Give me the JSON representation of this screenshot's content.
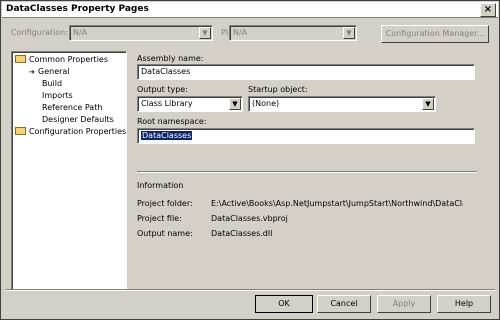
{
  "window": {
    "title": "DataClasses Property Pages",
    "close_glyph": "×"
  },
  "header": {
    "configuration_label": "Configuration:",
    "configuration_value": "N/A",
    "platform_label": "Platform:",
    "platform_value": "N/A",
    "configuration_manager_label": "Configuration Manager..."
  },
  "tree": {
    "items": [
      {
        "label": "Common Properties",
        "expanded": true
      },
      {
        "label": "General",
        "selected": true
      },
      {
        "label": "Build"
      },
      {
        "label": "Imports"
      },
      {
        "label": "Reference Path"
      },
      {
        "label": "Designer Defaults"
      },
      {
        "label": "Configuration Properties"
      }
    ]
  },
  "form": {
    "assembly_name_label": "Assembly name:",
    "assembly_name_value": "DataClasses",
    "output_type_label": "Output type:",
    "output_type_value": "Class Library",
    "startup_object_label": "Startup object:",
    "startup_object_value": "(None)",
    "root_namespace_label": "Root namespace:",
    "root_namespace_value": "DataClasses"
  },
  "information": {
    "heading": "Information",
    "project_folder_label": "Project folder:",
    "project_folder_value": "E:\\Active\\Books\\Asp.NetJumpstart\\JumpStart\\Northwind\\DataClasses",
    "project_file_label": "Project file:",
    "project_file_value": "DataClasses.vbproj",
    "output_name_label": "Output name:",
    "output_name_value": "DataClasses.dll"
  },
  "buttons": {
    "ok": "OK",
    "cancel": "Cancel",
    "apply": "Apply",
    "help": "Help"
  }
}
